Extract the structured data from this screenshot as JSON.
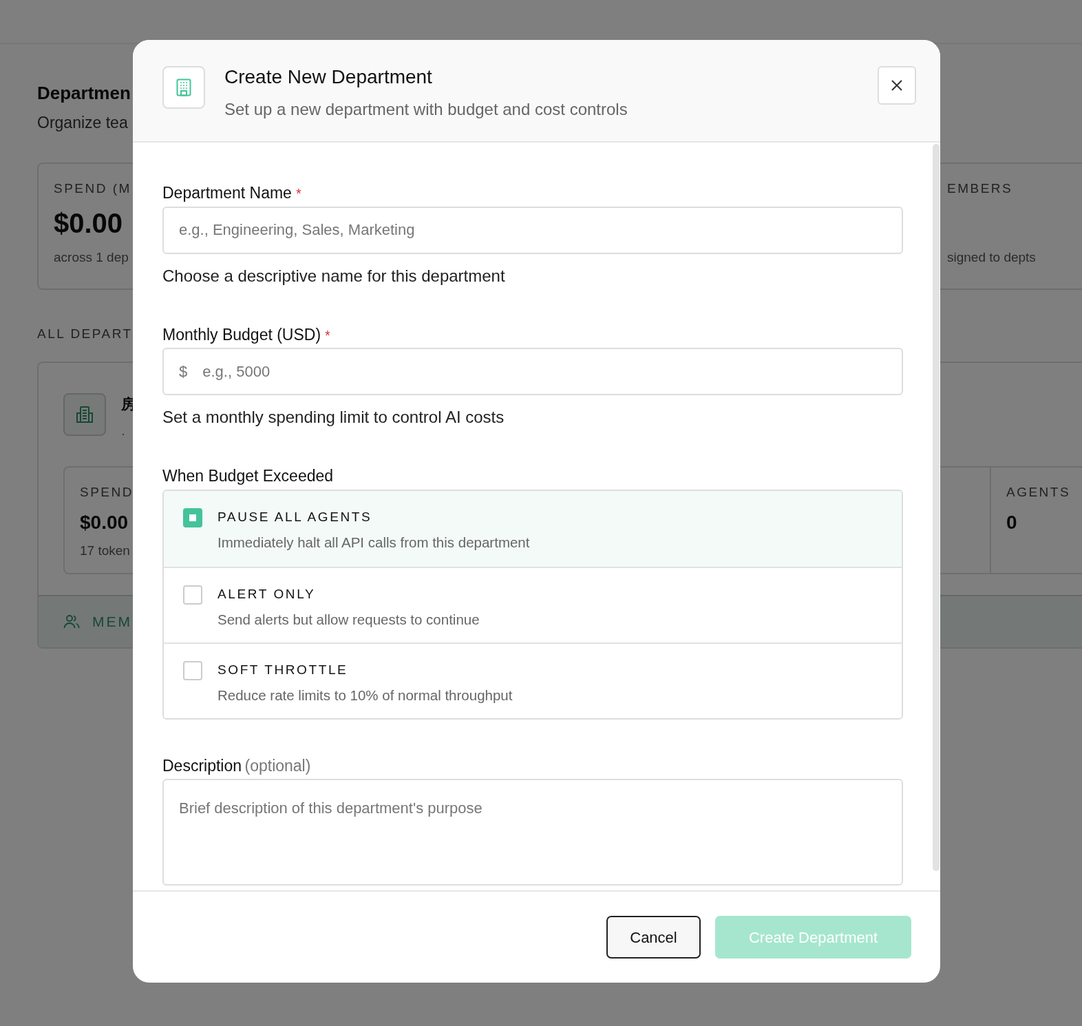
{
  "page": {
    "title": "Departmen",
    "subtitle": "Organize tea",
    "summary_cards": [
      {
        "label": "SPEND (M",
        "value": "$0.00",
        "note": "across 1 dep"
      },
      {
        "label": "EMBERS",
        "note": "signed to depts"
      }
    ],
    "section_label": "ALL DEPART",
    "department": {
      "name": "房",
      "meta": "·",
      "stats": [
        {
          "label": "SPEND",
          "value": "$0.00",
          "note": "17 token"
        },
        {
          "label": "AGENTS",
          "value": "0"
        }
      ],
      "footer_link": "MEM"
    }
  },
  "dialog": {
    "title": "Create New Department",
    "subtitle": "Set up a new department with budget and cost controls",
    "name_field": {
      "label": "Department Name",
      "required_mark": "*",
      "placeholder": "e.g., Engineering, Sales, Marketing",
      "help": "Choose a descriptive name for this department"
    },
    "budget_field": {
      "label": "Monthly Budget (USD)",
      "required_mark": "*",
      "prefix": "$",
      "placeholder": "e.g., 5000",
      "help": "Set a monthly spending limit to control AI costs"
    },
    "budget_action": {
      "label": "When Budget Exceeded",
      "options": [
        {
          "title": "PAUSE ALL AGENTS",
          "description": "Immediately halt all API calls from this department",
          "selected": true
        },
        {
          "title": "ALERT ONLY",
          "description": "Send alerts but allow requests to continue",
          "selected": false
        },
        {
          "title": "SOFT THROTTLE",
          "description": "Reduce rate limits to 10% of normal throughput",
          "selected": false
        }
      ]
    },
    "description_field": {
      "label": "Description",
      "hint": "(optional)",
      "placeholder": "Brief description of this department's purpose"
    },
    "buttons": [
      {
        "kind": "cancel",
        "label": "Cancel",
        "disabled": false
      },
      {
        "kind": "primary",
        "label": "Create Department",
        "disabled": true
      }
    ]
  }
}
